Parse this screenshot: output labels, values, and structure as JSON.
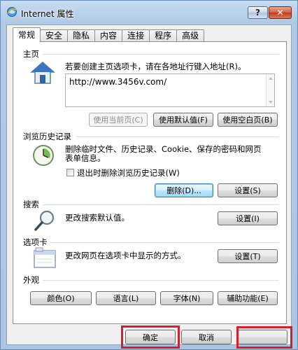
{
  "window": {
    "title": "Internet 属性",
    "help_label": "?",
    "close_label": "✕"
  },
  "tabs": [
    {
      "label": "常规",
      "active": true
    },
    {
      "label": "安全"
    },
    {
      "label": "隐私"
    },
    {
      "label": "内容"
    },
    {
      "label": "连接"
    },
    {
      "label": "程序"
    },
    {
      "label": "高级"
    }
  ],
  "homepage": {
    "title": "主页",
    "description": "若要创建主页选项卡，请在各地址行键入地址(R)。",
    "url": "http://www.3456v.com/",
    "use_current": "使用当前页(C)",
    "use_default": "使用默认值(F)",
    "use_blank": "使用空白页(B)"
  },
  "history": {
    "title": "浏览历史记录",
    "description_line1": "删除临时文件、历史记录、Cookie、保存的密码和网页",
    "description_line2": "表单信息。",
    "checkbox_label": "退出时删除浏览历史记录(W)",
    "delete_button": "删除(D)...",
    "settings_button": "设置(S)"
  },
  "search": {
    "title": "搜索",
    "description": "更改搜索默认值。",
    "settings_button": "设置(I)"
  },
  "tabs_section": {
    "title": "选项卡",
    "description": "更改网页在选项卡中显示的方式。",
    "settings_button": "设置(T)"
  },
  "appearance": {
    "title": "外观",
    "colors": "颜色(O)",
    "languages": "语言(L)",
    "fonts": "字体(N)",
    "accessibility": "辅助功能(E)"
  },
  "footer": {
    "ok": "确定",
    "cancel": "取消"
  }
}
